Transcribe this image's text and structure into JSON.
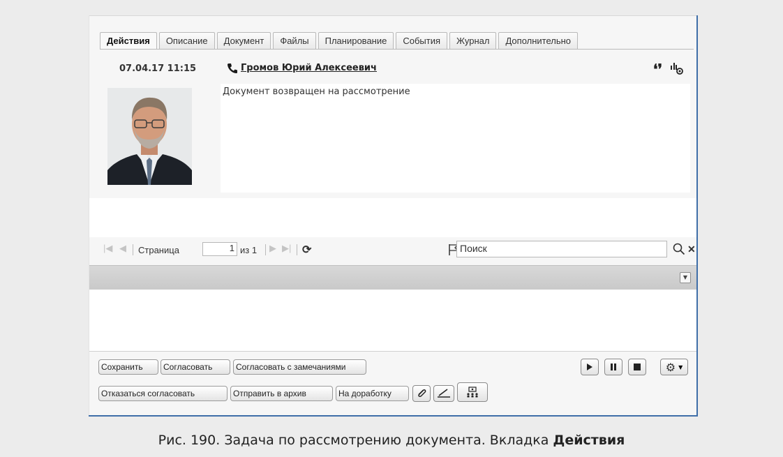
{
  "tabs": [
    {
      "label": "Действия",
      "active": true
    },
    {
      "label": "Описание",
      "active": false
    },
    {
      "label": "Документ",
      "active": false
    },
    {
      "label": "Файлы",
      "active": false
    },
    {
      "label": "Планирование",
      "active": false
    },
    {
      "label": "События",
      "active": false
    },
    {
      "label": "Журнал",
      "active": false
    },
    {
      "label": "Дополнительно",
      "active": false
    }
  ],
  "message": {
    "date": "07.04.17 11:15",
    "author": "Громов Юрий Алексеевич",
    "text": "Документ возвращен на рассмотрение"
  },
  "pager": {
    "page_label": "Страница",
    "page_value": "1",
    "of_label": "из 1",
    "search_placeholder": "Поиск"
  },
  "buttons_row1": {
    "save": "Сохранить",
    "approve": "Согласовать",
    "approve_with_notes": "Согласовать с замечаниями"
  },
  "buttons_row2": {
    "decline": "Отказаться согласовать",
    "archive": "Отправить в архив",
    "rework": "На доработку"
  },
  "caption": {
    "text": "Рис. 190. Задача по рассмотрению документа. Вкладка ",
    "bold": "Действия"
  },
  "colors": {
    "border_accent": "#3f6ea8",
    "panel_bg": "#f6f6f6"
  },
  "icons": [
    "phone-icon",
    "quote-icon",
    "hand-icon",
    "refresh-icon",
    "flag-icon",
    "search-icon",
    "clear-icon",
    "paperclip-icon",
    "signature-icon",
    "users-icon",
    "play-icon",
    "pause-icon",
    "stop-icon",
    "gear-icon"
  ]
}
